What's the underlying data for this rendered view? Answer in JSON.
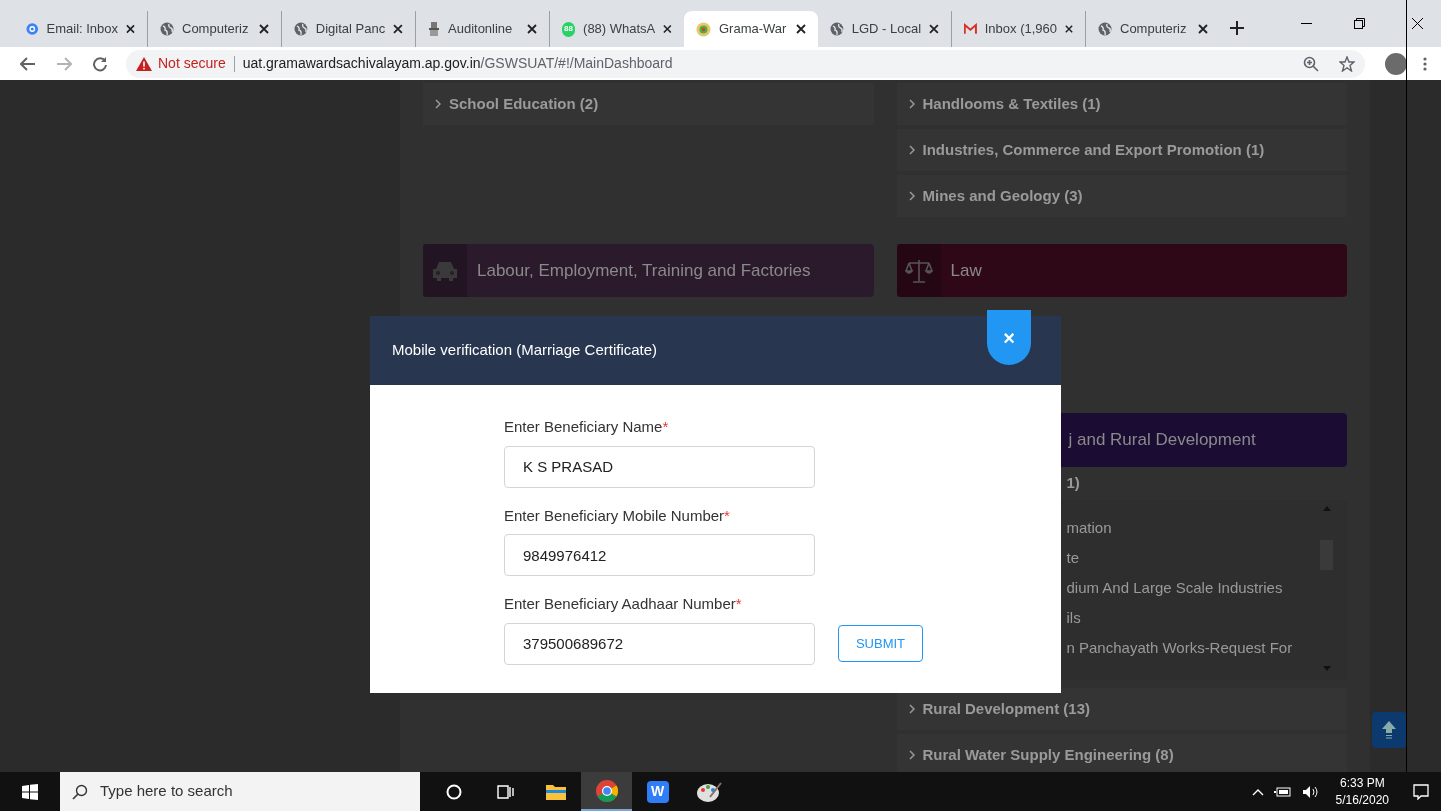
{
  "browser": {
    "tabs": [
      {
        "title": "Email: Inbox",
        "kind": "at",
        "selected": false
      },
      {
        "title": "Computeriz",
        "kind": "globe",
        "selected": false
      },
      {
        "title": "Digital Panc",
        "kind": "globe",
        "selected": false
      },
      {
        "title": "Auditonline",
        "kind": "emblem",
        "selected": false
      },
      {
        "title": "(88) WhatsA",
        "kind": "chat",
        "badge": "88",
        "selected": false
      },
      {
        "title": "Grama-War",
        "kind": "seal",
        "selected": true
      },
      {
        "title": "LGD - Local",
        "kind": "globe",
        "selected": false
      },
      {
        "title": "Inbox (1,960",
        "kind": "mail",
        "selected": false
      },
      {
        "title": "Computeriz",
        "kind": "globe",
        "selected": false
      }
    ],
    "security_label": "Not secure",
    "url_host": "uat.gramawardsachivalayam.ap.gov.in",
    "url_path": "/GSWSUAT/#!/MainDashboard"
  },
  "page": {
    "left_items": [
      "School Education (2)"
    ],
    "right_items": [
      "Handlooms & Textiles (1)",
      "Industries, Commerce and Export Promotion (1)",
      "Mines and Geology (3)"
    ],
    "headers": [
      {
        "title": "Labour, Employment, Training and Factories",
        "kind": "car",
        "color": "#2b1a2b"
      },
      {
        "title": "Law",
        "kind": "scales",
        "color": "#2f0818"
      }
    ],
    "panchayat_header": {
      "title": "j and Rural Development",
      "color": "#1b0c33"
    },
    "panchayat_count": "1)",
    "service_list": [
      "mation",
      "te",
      "dium And Large Scale Industries",
      "ils",
      "n Panchayath Works-Request For"
    ],
    "lower_items": [
      "Rural Development (13)",
      "Rural Water Supply Engineering (8)"
    ]
  },
  "modal": {
    "title": "Mobile verification (Marriage Certificate)",
    "close": "×",
    "fields": [
      {
        "label": "Enter Beneficiary Name",
        "required_mark": "*",
        "value": "K S PRASAD"
      },
      {
        "label": "Enter Beneficiary Mobile Number",
        "required_mark": "*",
        "value": "9849976412"
      },
      {
        "label": "Enter Beneficiary Aadhaar Number",
        "required_mark": "*",
        "value": "379500689672"
      }
    ],
    "submit": "SUBMIT"
  },
  "taskbar": {
    "search_placeholder": "Type here to search",
    "apps": [
      {
        "kind": "cortana",
        "selected": false
      },
      {
        "kind": "taskview",
        "selected": false
      },
      {
        "kind": "folder",
        "selected": false
      },
      {
        "kind": "chrome",
        "selected": true
      },
      {
        "kind": "wps",
        "label": "W",
        "selected": false
      },
      {
        "kind": "paint",
        "selected": false
      }
    ],
    "time": "6:33 PM",
    "date": "5/16/2020"
  }
}
